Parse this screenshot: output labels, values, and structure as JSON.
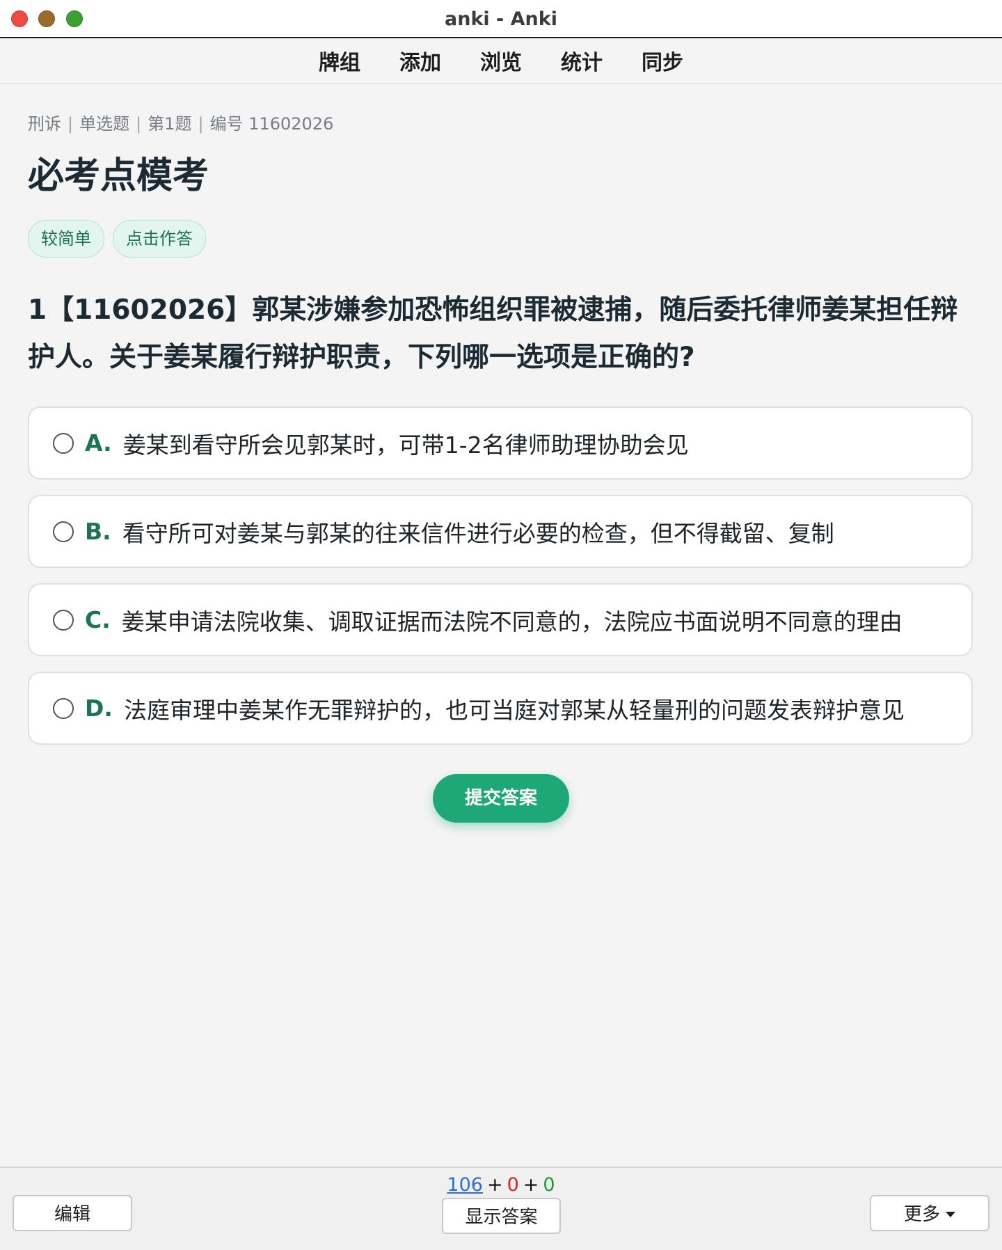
{
  "window": {
    "title": "anki - Anki"
  },
  "toolbar": {
    "items": [
      "牌组",
      "添加",
      "浏览",
      "统计",
      "同步"
    ]
  },
  "card": {
    "breadcrumb": [
      "刑诉",
      "单选题",
      "第1题",
      "编号 11602026"
    ],
    "breadcrumb_separator": "|",
    "title": "必考点模考",
    "tags": [
      "较简单",
      "点击作答"
    ],
    "question": "1【11602026】郭某涉嫌参加恐怖组织罪被逮捕，随后委托律师姜某担任辩护人。关于姜某履行辩护职责，下列哪一选项是正确的?",
    "options": [
      {
        "letter": "A.",
        "text": "姜某到看守所会见郭某时，可带1-2名律师助理协助会见"
      },
      {
        "letter": "B.",
        "text": "看守所可对姜某与郭某的往来信件进行必要的检查，但不得截留、复制"
      },
      {
        "letter": "C.",
        "text": "姜某申请法院收集、调取证据而法院不同意的，法院应书面说明不同意的理由"
      },
      {
        "letter": "D.",
        "text": "法庭审理中姜某作无罪辩护的，也可当庭对郭某从轻量刑的问题发表辩护意见"
      }
    ],
    "submit_label": "提交答案"
  },
  "bottom": {
    "counts": {
      "new": "106",
      "learning": "0",
      "review": "0",
      "plus": "+"
    },
    "edit_label": "编辑",
    "show_answer_label": "显示答案",
    "more_label": "更多"
  },
  "colors": {
    "accent": "#1fa877",
    "option_letter": "#1d7355",
    "count_new": "#2b6fdb",
    "count_learning": "#d8241f",
    "count_review": "#1b9a2f"
  }
}
